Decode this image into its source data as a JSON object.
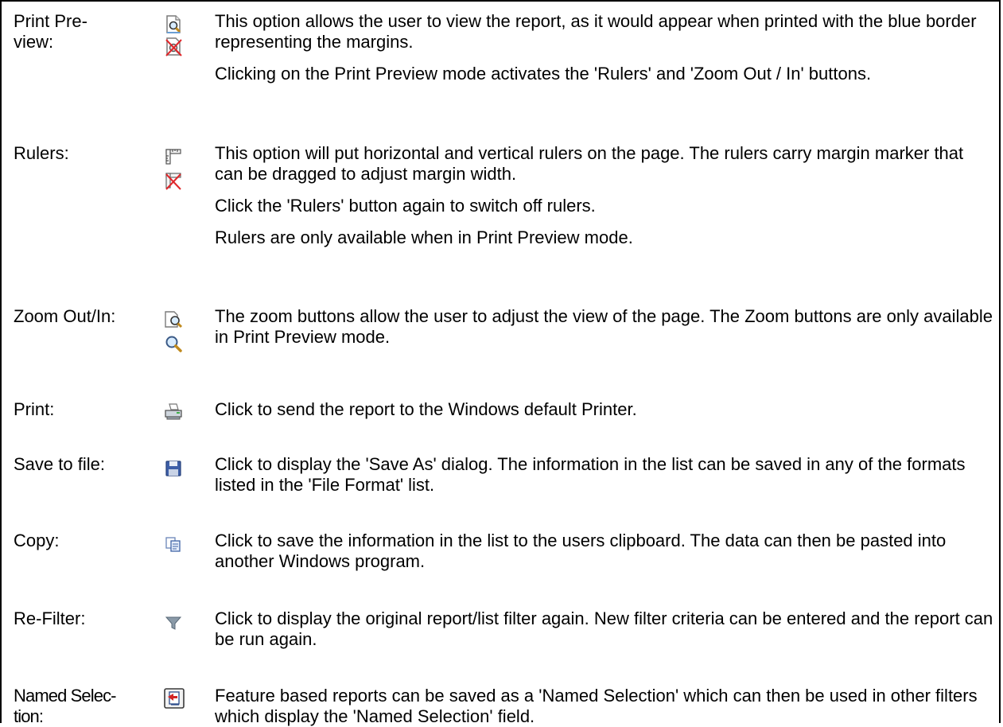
{
  "rows": [
    {
      "label": "Print Pre-\nview:",
      "icons": [
        "print-preview-icon",
        "print-preview-off-icon"
      ],
      "paragraphs": [
        "This option allows the user to view the report, as it would appear when printed with the blue border representing the margins.",
        "Clicking on the Print Preview mode activates the 'Rulers' and 'Zoom Out / In' buttons."
      ]
    },
    {
      "label": "Rulers:",
      "icons": [
        "rulers-icon",
        "rulers-off-icon"
      ],
      "paragraphs": [
        "This option will put horizontal and vertical rulers on the page. The rulers carry margin marker that can be dragged to adjust margin width.",
        "Click the 'Rulers' button again to switch off rulers.",
        "Rulers are only available when in Print Preview mode."
      ]
    },
    {
      "label": "Zoom Out/In:",
      "icons": [
        "zoom-out-icon",
        "zoom-in-icon"
      ],
      "paragraphs": [
        "The zoom buttons allow the user to adjust the view of the page. The Zoom buttons are only available in Print Preview mode."
      ]
    },
    {
      "label": "Print:",
      "icons": [
        "printer-icon"
      ],
      "paragraphs": [
        "Click to send the report to the Windows default Printer."
      ]
    },
    {
      "label": "Save to file:",
      "icons": [
        "floppy-disk-icon"
      ],
      "paragraphs": [
        "Click to display the 'Save As' dialog. The information in the list can be saved in any of the formats listed in the 'File Format' list."
      ]
    },
    {
      "label": "Copy:",
      "icons": [
        "copy-icon"
      ],
      "paragraphs": [
        "Click to save the information in the list to the users clipboard. The data can then be pasted into another Windows program."
      ]
    },
    {
      "label": "Re-Filter:",
      "icons": [
        "filter-icon"
      ],
      "paragraphs": [
        "Click to display the original report/list filter again. New filter criteria can be entered and the report can be run again."
      ]
    },
    {
      "label": "Named Selec-\ntion:",
      "icons": [
        "named-selection-icon"
      ],
      "paragraphs": [
        "Feature based reports can be saved as a 'Named Selection' which can then be used in other filters which display the 'Named Selection' field."
      ]
    }
  ]
}
